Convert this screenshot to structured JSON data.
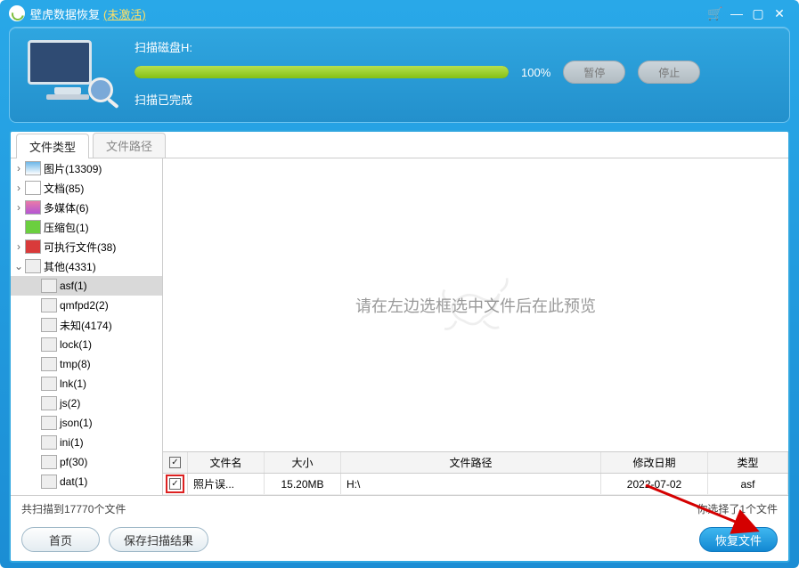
{
  "titlebar": {
    "app_name": "壁虎数据恢复",
    "activation": "(未激活)"
  },
  "scan": {
    "label_disk": "扫描磁盘H:",
    "percent": "100%",
    "pause": "暂停",
    "stop": "停止",
    "done": "扫描已完成"
  },
  "tabs": {
    "type": "文件类型",
    "path": "文件路径"
  },
  "tree": [
    {
      "lvl": 0,
      "exp": ">",
      "icon": "pic",
      "label": "图片(13309)"
    },
    {
      "lvl": 0,
      "exp": ">",
      "icon": "doc",
      "label": "文档(85)"
    },
    {
      "lvl": 0,
      "exp": ">",
      "icon": "media",
      "label": "多媒体(6)"
    },
    {
      "lvl": 0,
      "exp": "",
      "icon": "zip",
      "label": "压缩包(1)"
    },
    {
      "lvl": 0,
      "exp": ">",
      "icon": "exe",
      "label": "可执行文件(38)"
    },
    {
      "lvl": 0,
      "exp": "v",
      "icon": "gen",
      "label": "其他(4331)"
    },
    {
      "lvl": 1,
      "exp": "",
      "icon": "gen",
      "label": "asf(1)",
      "selected": true
    },
    {
      "lvl": 1,
      "exp": "",
      "icon": "gen",
      "label": "qmfpd2(2)"
    },
    {
      "lvl": 1,
      "exp": "",
      "icon": "gen",
      "label": "未知(4174)"
    },
    {
      "lvl": 1,
      "exp": "",
      "icon": "gen",
      "label": "lock(1)"
    },
    {
      "lvl": 1,
      "exp": "",
      "icon": "gen",
      "label": "tmp(8)"
    },
    {
      "lvl": 1,
      "exp": "",
      "icon": "gen",
      "label": "lnk(1)"
    },
    {
      "lvl": 1,
      "exp": "",
      "icon": "gen",
      "label": "js(2)"
    },
    {
      "lvl": 1,
      "exp": "",
      "icon": "gen",
      "label": "json(1)"
    },
    {
      "lvl": 1,
      "exp": "",
      "icon": "gen",
      "label": "ini(1)"
    },
    {
      "lvl": 1,
      "exp": "",
      "icon": "gen",
      "label": "pf(30)"
    },
    {
      "lvl": 1,
      "exp": "",
      "icon": "gen",
      "label": "dat(1)"
    }
  ],
  "preview_hint": "请在左边选框选中文件后在此预览",
  "table": {
    "headers": {
      "name": "文件名",
      "size": "大小",
      "path": "文件路径",
      "date": "修改日期",
      "type": "类型"
    },
    "rows": [
      {
        "checked": true,
        "name": "照片误...",
        "size": "15.20MB",
        "path": "H:\\",
        "date": "2022-07-02",
        "type": "asf"
      }
    ]
  },
  "footer": {
    "scanned": "共扫描到17770个文件",
    "selected": "你选择了1个文件",
    "home": "首页",
    "save_result": "保存扫描结果",
    "recover": "恢复文件"
  }
}
